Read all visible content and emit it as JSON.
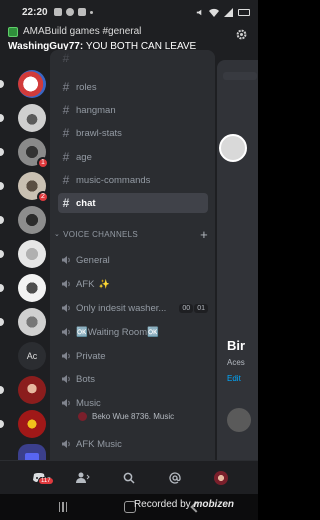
{
  "status_bar": {
    "time": "22:20"
  },
  "notification": {
    "app_line": "AMABuild games #general",
    "sender": "WashingGuy77:",
    "message": "YOU BOTH CAN LEAVE"
  },
  "servers": [
    {
      "name": "server-1",
      "color": "#d13b3b",
      "badge": ""
    },
    {
      "name": "server-2",
      "color": "#b9b9b9",
      "badge": ""
    },
    {
      "name": "server-3",
      "color": "#8a8a8a",
      "badge": "1"
    },
    {
      "name": "server-4",
      "color": "#a9a39a",
      "badge": "2"
    },
    {
      "name": "server-5",
      "color": "#6b6b6b",
      "badge": ""
    },
    {
      "name": "server-6",
      "color": "#cfcfcf",
      "badge": ""
    },
    {
      "name": "server-7",
      "color": "#e4e4e4",
      "badge": ""
    },
    {
      "name": "server-8",
      "color": "#bdbdbd",
      "badge": ""
    },
    {
      "name": "server-ac",
      "label": "Ac",
      "badge": ""
    },
    {
      "name": "server-10",
      "color": "#8b1d1d",
      "badge": ""
    },
    {
      "name": "server-11",
      "color": "#a01818",
      "badge": ""
    },
    {
      "name": "server-folder",
      "badge": ""
    },
    {
      "name": "server-13",
      "color": "#2a6fb5",
      "badge": ""
    }
  ],
  "text_channels": [
    {
      "name": "roles"
    },
    {
      "name": "hangman"
    },
    {
      "name": "brawl-stats"
    },
    {
      "name": "age"
    },
    {
      "name": "music-commands"
    },
    {
      "name": "chat",
      "active": true
    }
  ],
  "voice_category": {
    "label": "VOICE CHANNELS"
  },
  "voice_channels": [
    {
      "name": "General",
      "extra": ""
    },
    {
      "name": "AFK",
      "extra": "✨"
    },
    {
      "name": "Only indesit washer...",
      "extra": "",
      "counts": [
        "00",
        "01"
      ]
    },
    {
      "name": "🆗Waiting Room🆗",
      "extra": ""
    },
    {
      "name": "Private",
      "extra": ""
    },
    {
      "name": "Bots",
      "extra": ""
    },
    {
      "name": "Music",
      "extra": ""
    },
    {
      "name": "AFK Music",
      "extra": ""
    }
  ],
  "music_member": {
    "name": "Beko Wue 8736. Music"
  },
  "preview": {
    "title": "Bir",
    "sub1": "Aces",
    "sub2": "Edit"
  },
  "bottom_nav": {
    "home_badge": "117"
  },
  "watermark": {
    "prefix": "Recorded by",
    "brand": "mobizen"
  },
  "colors": {
    "active_channel_bg": "#404249",
    "badge_red": "#e03a3e",
    "link_blue": "#00a8fc"
  }
}
